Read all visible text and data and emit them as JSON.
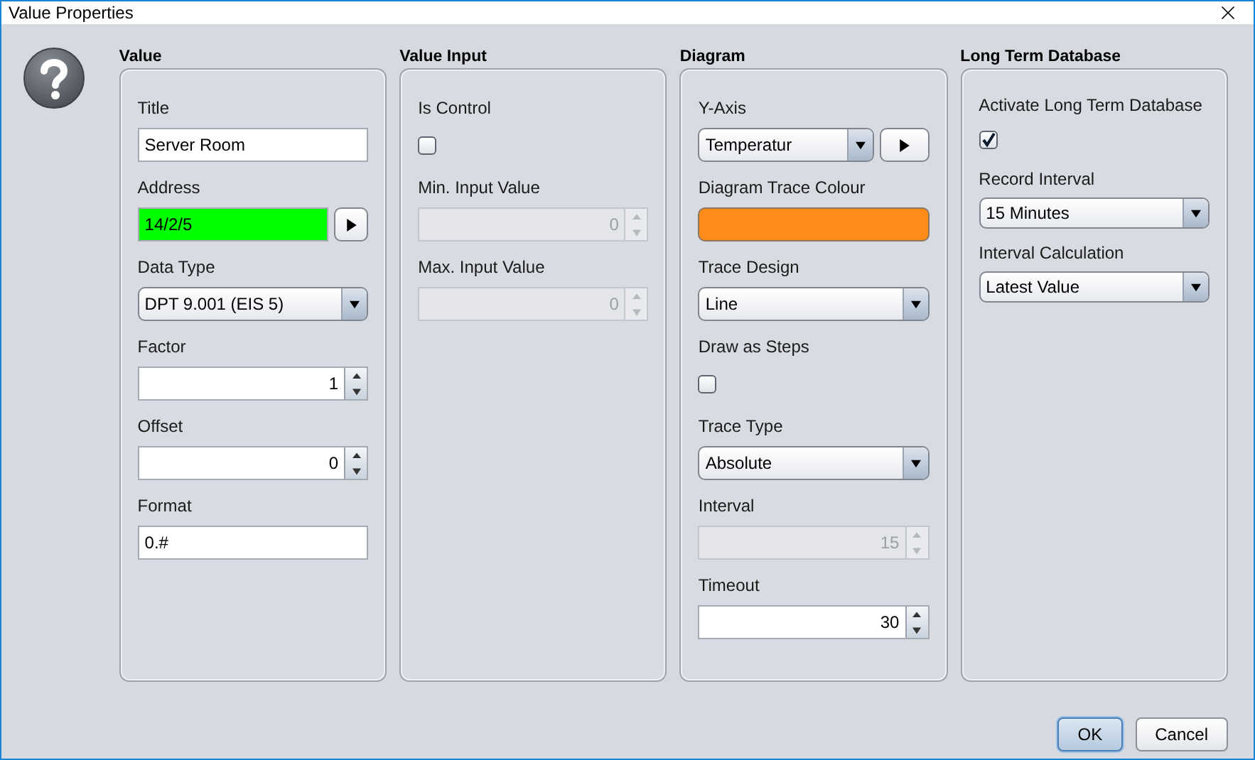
{
  "window": {
    "title": "Value Properties"
  },
  "groups": [
    {
      "title": "Value",
      "compact": false,
      "fields": [
        {
          "kind": "text",
          "label": "Title",
          "value": "Server Room"
        },
        {
          "kind": "address",
          "label": "Address",
          "value": "14/2/5",
          "valid": true
        },
        {
          "kind": "select",
          "label": "Data Type",
          "value": "DPT 9.001 (EIS 5)"
        },
        {
          "kind": "spinner",
          "label": "Factor",
          "value": "1",
          "disabled": false
        },
        {
          "kind": "spinner",
          "label": "Offset",
          "value": "0",
          "disabled": false
        },
        {
          "kind": "text",
          "label": "Format",
          "value": "0.#"
        }
      ]
    },
    {
      "title": "Value Input",
      "compact": false,
      "fields": [
        {
          "kind": "checkbox",
          "label": "Is Control",
          "checked": false
        },
        {
          "kind": "spinner",
          "label": "Min. Input Value",
          "value": "0",
          "disabled": true
        },
        {
          "kind": "spinner",
          "label": "Max. Input Value",
          "value": "0",
          "disabled": true
        }
      ]
    },
    {
      "title": "Diagram",
      "compact": false,
      "fields": [
        {
          "kind": "select_button",
          "label": "Y-Axis",
          "value": "Temperatur"
        },
        {
          "kind": "color",
          "label": "Diagram Trace Colour",
          "color": "#ff8c1a"
        },
        {
          "kind": "select",
          "label": "Trace Design",
          "value": "Line"
        },
        {
          "kind": "checkbox",
          "label": "Draw as Steps",
          "checked": false
        },
        {
          "kind": "select",
          "label": "Trace Type",
          "value": "Absolute"
        },
        {
          "kind": "spinner",
          "label": "Interval",
          "value": "15",
          "disabled": true
        },
        {
          "kind": "spinner",
          "label": "Timeout",
          "value": "30",
          "disabled": false
        }
      ]
    },
    {
      "title": "Long Term Database",
      "compact": true,
      "fields": [
        {
          "kind": "checkbox",
          "label": "Activate Long Term Database",
          "checked": true
        },
        {
          "kind": "select",
          "label": "Record Interval",
          "value": "15 Minutes"
        },
        {
          "kind": "select",
          "label": "Interval Calculation",
          "value": "Latest Value"
        }
      ]
    }
  ],
  "buttons": [
    {
      "label": "OK",
      "default": true
    },
    {
      "label": "Cancel",
      "default": false
    }
  ]
}
